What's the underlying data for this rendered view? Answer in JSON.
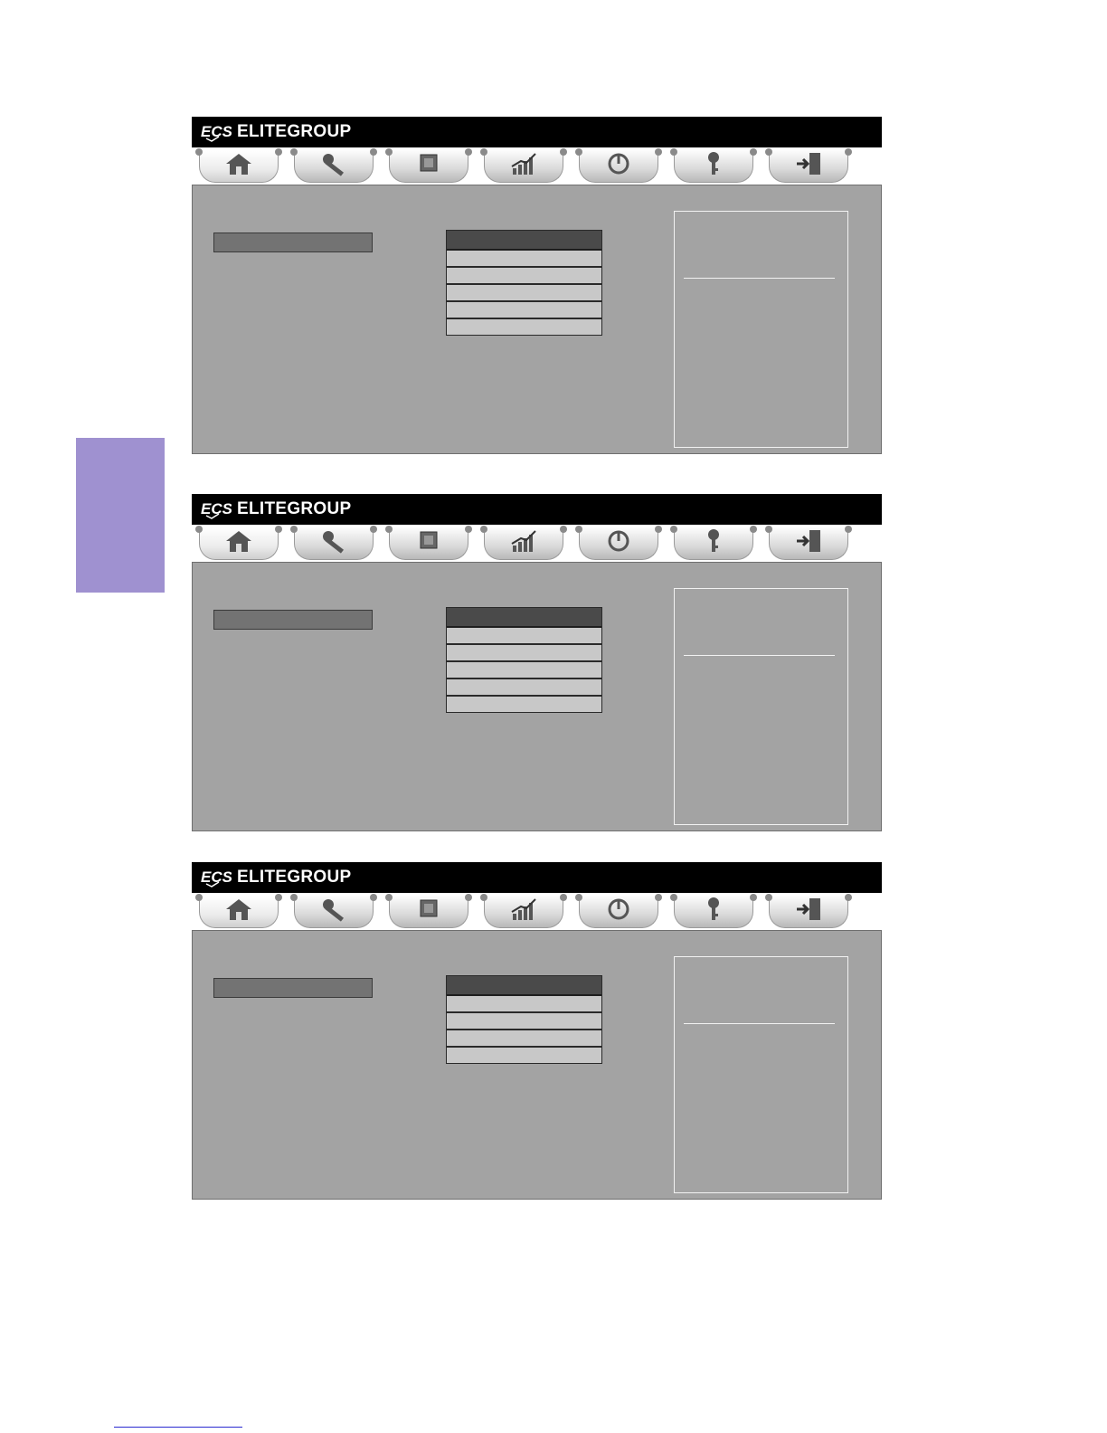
{
  "brand": "ELITEGROUP",
  "tabs": [
    {
      "icon": "home-icon"
    },
    {
      "icon": "wrench-icon"
    },
    {
      "icon": "chip-icon"
    },
    {
      "icon": "chart-icon"
    },
    {
      "icon": "power-icon"
    },
    {
      "icon": "key-icon"
    },
    {
      "icon": "exit-icon"
    }
  ],
  "panels": [
    {
      "option_count": 5
    },
    {
      "option_count": 5
    },
    {
      "option_count": 4
    }
  ],
  "colors": {
    "titlebar": "#000000",
    "body": "#a3a3a3",
    "selected": "#737373",
    "option": "#c8c8c8",
    "option_header": "#4a4a4a",
    "side_tab": "#9f91d0"
  }
}
